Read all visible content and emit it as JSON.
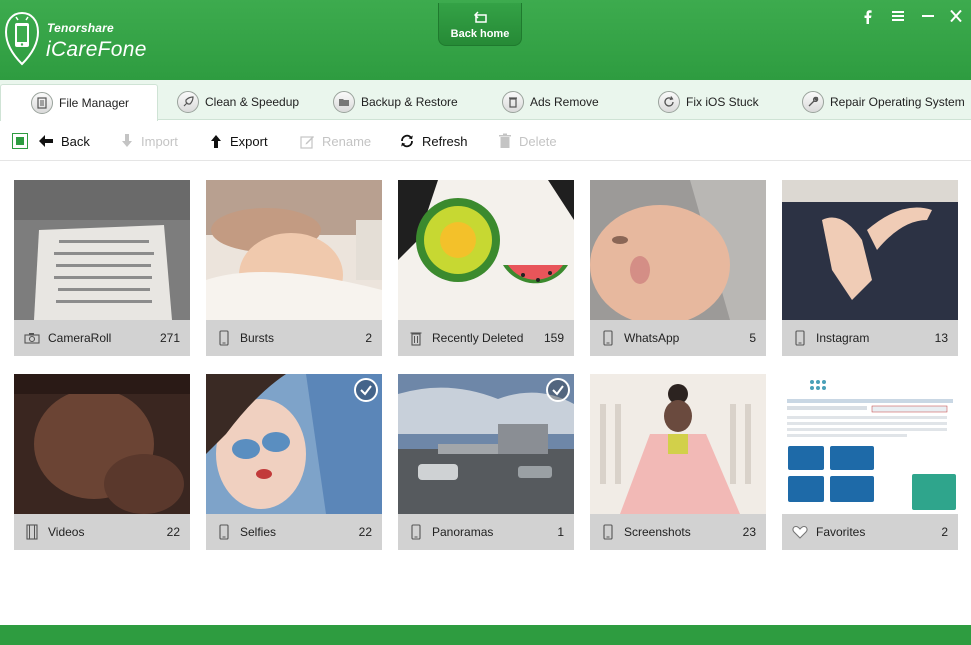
{
  "header": {
    "brand_small": "Tenorshare",
    "brand_big": "iCareFone",
    "back_home_label": "Back home",
    "window_controls": [
      "facebook-icon",
      "menu-icon",
      "minimize-icon",
      "close-icon"
    ]
  },
  "nav": {
    "tabs": [
      {
        "label": "File Manager",
        "icon": "file-manager-icon",
        "active": true
      },
      {
        "label": "Clean & Speedup",
        "icon": "rocket-icon",
        "active": false
      },
      {
        "label": "Backup & Restore",
        "icon": "folder-icon",
        "active": false
      },
      {
        "label": "Ads Remove",
        "icon": "trash-icon",
        "active": false
      },
      {
        "label": "Fix iOS Stuck",
        "icon": "refresh-icon",
        "active": false
      },
      {
        "label": "Repair Operating System",
        "icon": "wrench-icon",
        "active": false
      }
    ]
  },
  "toolbar": {
    "back": "Back",
    "import": "Import",
    "export": "Export",
    "rename": "Rename",
    "refresh": "Refresh",
    "delete": "Delete"
  },
  "albums": [
    {
      "label": "CameraRoll",
      "count": "271",
      "icon": "camera-icon",
      "checked": false
    },
    {
      "label": "Bursts",
      "count": "2",
      "icon": "phone-icon",
      "checked": false
    },
    {
      "label": "Recently Deleted",
      "count": "159",
      "icon": "trash-icon",
      "checked": false
    },
    {
      "label": "WhatsApp",
      "count": "5",
      "icon": "phone-icon",
      "checked": false
    },
    {
      "label": "Instagram",
      "count": "13",
      "icon": "phone-icon",
      "checked": false
    },
    {
      "label": "Videos",
      "count": "22",
      "icon": "film-icon",
      "checked": false
    },
    {
      "label": "Selfies",
      "count": "22",
      "icon": "phone-icon",
      "checked": true
    },
    {
      "label": "Panoramas",
      "count": "1",
      "icon": "phone-icon",
      "checked": true
    },
    {
      "label": "Screenshots",
      "count": "23",
      "icon": "phone-icon",
      "checked": false
    },
    {
      "label": "Favorites",
      "count": "2",
      "icon": "heart-icon",
      "checked": false
    }
  ],
  "colors": {
    "brand_green": "#2e9c40",
    "nav_bg": "#eaf6ed",
    "caption_bg": "#cdcdcd"
  }
}
